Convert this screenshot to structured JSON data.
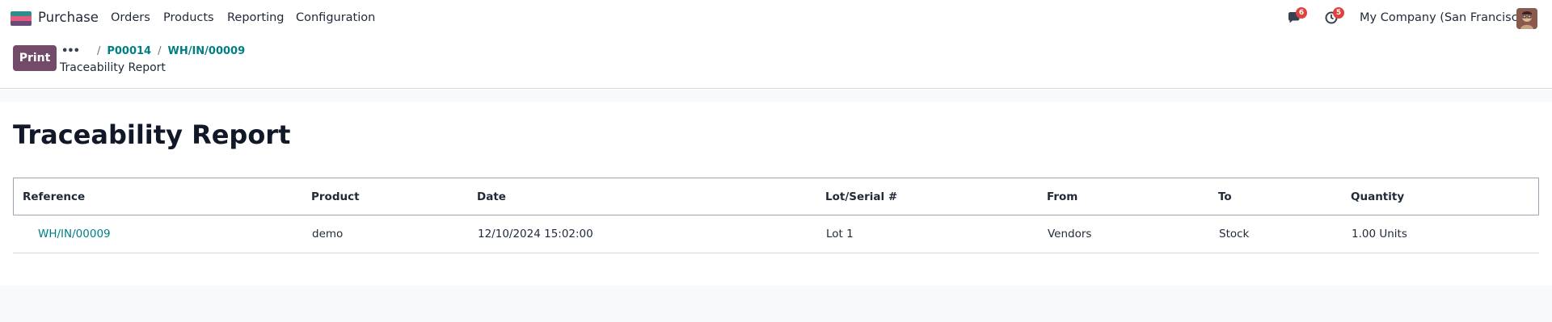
{
  "navbar": {
    "app_name": "Purchase",
    "menu": [
      {
        "label": "Orders"
      },
      {
        "label": "Products"
      },
      {
        "label": "Reporting"
      },
      {
        "label": "Configuration"
      }
    ],
    "messages_count": "6",
    "activities_count": "5",
    "company": "My Company (San Francisco)",
    "icons": {
      "messages": "chat-icon",
      "activities": "clock-icon",
      "avatar": "user-avatar"
    }
  },
  "control_panel": {
    "print_label": "Print",
    "breadcrumb_more": "•••",
    "breadcrumbs": [
      "P00014",
      "WH/IN/00009"
    ],
    "separator": "/",
    "subtitle": "Traceability Report"
  },
  "report": {
    "title": "Traceability Report",
    "columns": [
      "Reference",
      "Product",
      "Date",
      "Lot/Serial #",
      "From",
      "To",
      "Quantity"
    ],
    "rows": [
      {
        "reference": "WH/IN/00009",
        "product": "demo",
        "date": "12/10/2024 15:02:00",
        "lot": "Lot 1",
        "from": "Vendors",
        "to": "Stock",
        "quantity": "1.00 Units"
      }
    ]
  },
  "colors": {
    "brand": "#714b67",
    "link": "#017e84",
    "badge": "#e0413c"
  }
}
